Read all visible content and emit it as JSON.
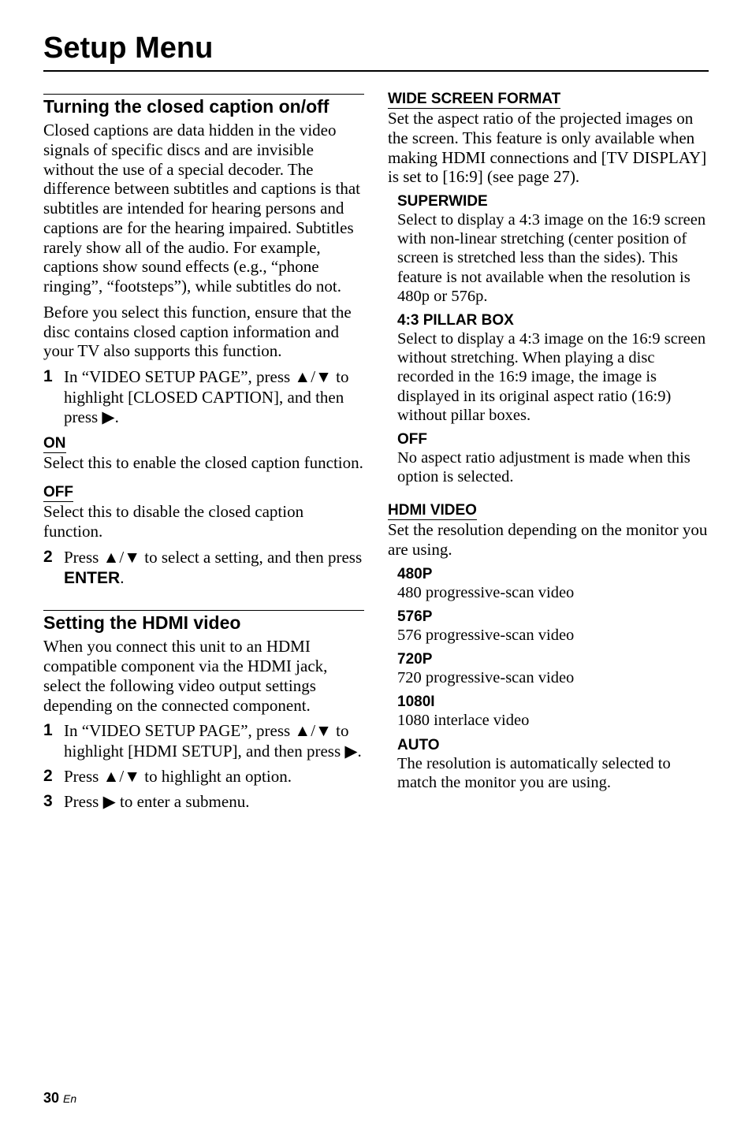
{
  "chapter": "Setup Menu",
  "footer": {
    "page": "30",
    "lang": "En"
  },
  "glyphs": {
    "up": "▲",
    "down": "▼",
    "right": "▶"
  },
  "left": {
    "sec1": {
      "title": "Turning the closed caption on/off",
      "para1": "Closed captions are data hidden in the video signals of specific discs and are invisible without the use of a special decoder. The difference between subtitles and captions is that subtitles are intended for hearing persons and captions are for the hearing impaired. Subtitles rarely show all of the audio. For example, captions show sound effects (e.g., “phone ringing”, “footsteps”), while subtitles do not.",
      "para2": "Before you select this function, ensure that the disc contains closed caption information and your TV also supports this function.",
      "step1a": "In “VIDEO SETUP PAGE”, press ",
      "step1b": " to highlight [CLOSED CAPTION], and then press ",
      "step1c": ".",
      "on": {
        "label": "ON",
        "text": "Select this to enable the closed caption function."
      },
      "off": {
        "label": "OFF",
        "text": "Select this to disable the closed caption function."
      },
      "step2a": "Press ",
      "step2b": " to select a setting, and then press ",
      "step2enter": "ENTER",
      "step2c": "."
    },
    "sec2": {
      "title": "Setting the HDMI video",
      "para": "When you connect this unit to an HDMI compatible component via the HDMI jack, select the following video output settings depending on the connected component.",
      "step1a": "In “VIDEO SETUP PAGE”, press ",
      "step1b": " to highlight [HDMI SETUP], and then press ",
      "step1c": ".",
      "step2a": "Press ",
      "step2b": " to highlight an option.",
      "step3a": "Press ",
      "step3b": " to enter a submenu."
    }
  },
  "right": {
    "wsf": {
      "label": "WIDE SCREEN FORMAT",
      "para": "Set the aspect ratio of the projected images on the screen. This feature is only available when making HDMI connections and [TV DISPLAY] is set to [16:9] (see page 27).",
      "superwide": {
        "label": "SUPERWIDE",
        "text": "Select to display a 4:3 image on the 16:9 screen with non-linear stretching (center position of screen is stretched less than the sides). This feature is not available when the resolution is 480p or 576p."
      },
      "pillar": {
        "label": "4:3 PILLAR BOX",
        "text": "Select to display a 4:3 image on the 16:9 screen without stretching. When playing a disc recorded in the 16:9 image, the image is displayed in its original aspect ratio (16:9) without pillar boxes."
      },
      "off": {
        "label": "OFF",
        "text": "No aspect ratio adjustment is made when this option is selected."
      }
    },
    "hdmi": {
      "label": "HDMI VIDEO",
      "para": "Set the resolution depending on the monitor you are using.",
      "r480": {
        "label": "480P",
        "text": "480 progressive-scan video"
      },
      "r576": {
        "label": "576P",
        "text": "576 progressive-scan video"
      },
      "r720": {
        "label": "720P",
        "text": "720 progressive-scan video"
      },
      "r1080": {
        "label": "1080I",
        "text": "1080 interlace video"
      },
      "auto": {
        "label": "AUTO",
        "text": "The resolution is automatically selected to match the monitor you are using."
      }
    }
  }
}
